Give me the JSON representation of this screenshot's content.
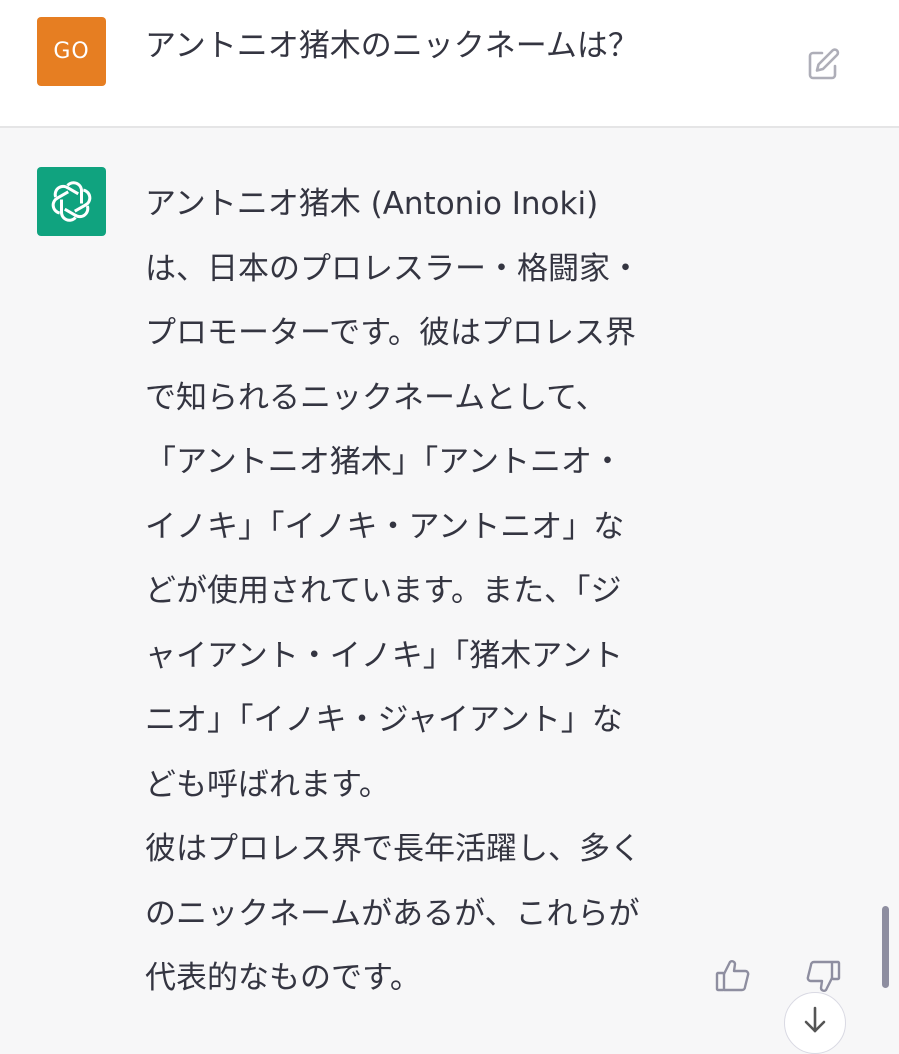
{
  "user_message": {
    "avatar_initials": "GO",
    "avatar_color": "#e67e22",
    "text": "アントニオ猪木のニックネームは？",
    "edit_icon": "edit-icon"
  },
  "assistant_message": {
    "avatar_icon": "openai-logo-icon",
    "avatar_color": "#10a37f",
    "lines": [
      "アントニオ猪木 (Antonio Inoki)",
      "は、日本のプロレスラー・格闘家・",
      "プロモーターです。彼はプロレス界",
      "で知られるニックネームとして、",
      "「アントニオ猪木」「アントニオ・",
      "イノキ」「イノキ・アントニオ」な",
      "どが使用されています。また、「ジ",
      "ャイアント・イノキ」「猪木アント",
      "ニオ」「イノキ・ジャイアント」な",
      "ども呼ばれます。",
      "彼はプロレス界で長年活躍し、多く",
      "のニックネームがあるが、これらが",
      "代表的なものです。"
    ],
    "feedback": {
      "thumbs_up_icon": "thumbs-up-icon",
      "thumbs_down_icon": "thumbs-down-icon"
    }
  },
  "scroll_down_icon": "arrow-down-icon"
}
